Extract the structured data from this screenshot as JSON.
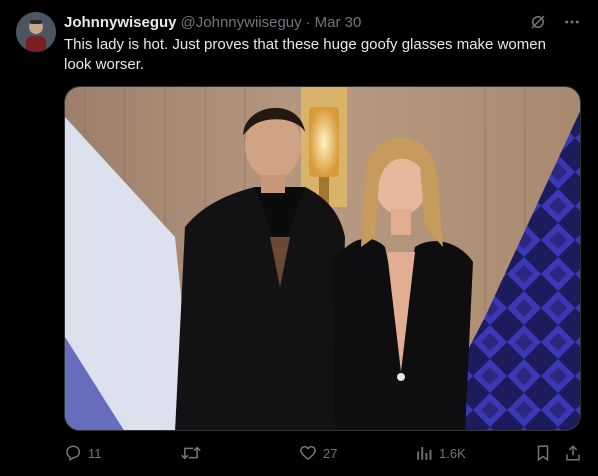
{
  "tweet": {
    "display_name": "Johnnywiseguy",
    "handle": "@Johnnywiiseguy",
    "separator": "·",
    "date": "Mar 30",
    "text": "This lady is hot. Just proves that these huge goofy glasses make women look worser."
  },
  "header_icons": [
    "grok-icon",
    "more-icon"
  ],
  "actions": {
    "reply_count": "11",
    "retweet_count": "",
    "like_count": "27",
    "views_count": "1.6K"
  },
  "colors": {
    "background": "#000000",
    "text_primary": "#e7e9ea",
    "text_secondary": "#71767b",
    "border": "#2f3336"
  }
}
